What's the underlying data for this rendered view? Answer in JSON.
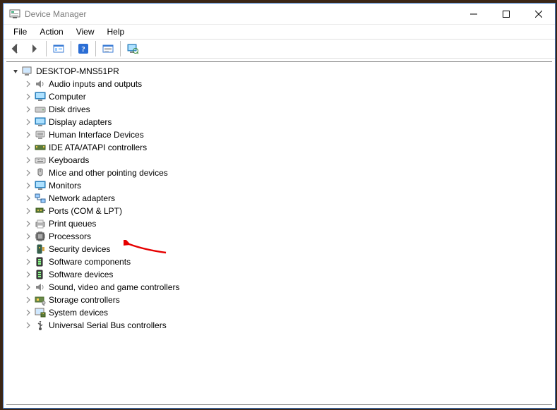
{
  "window": {
    "title": "Device Manager"
  },
  "menubar": {
    "items": [
      {
        "label": "File"
      },
      {
        "label": "Action"
      },
      {
        "label": "View"
      },
      {
        "label": "Help"
      }
    ]
  },
  "toolbar": {
    "back": "back-icon",
    "forward": "forward-icon",
    "show_hidden": "show-hidden-icon",
    "help": "help-icon",
    "properties": "properties-icon",
    "scan": "scan-monitor-icon"
  },
  "tree": {
    "root": {
      "label": "DESKTOP-MNS51PR",
      "expanded": true
    },
    "categories": [
      {
        "label": "Audio inputs and outputs",
        "icon": "speaker"
      },
      {
        "label": "Computer",
        "icon": "monitor"
      },
      {
        "label": "Disk drives",
        "icon": "disk"
      },
      {
        "label": "Display adapters",
        "icon": "monitor"
      },
      {
        "label": "Human Interface Devices",
        "icon": "hid"
      },
      {
        "label": "IDE ATA/ATAPI controllers",
        "icon": "ide"
      },
      {
        "label": "Keyboards",
        "icon": "keyboard"
      },
      {
        "label": "Mice and other pointing devices",
        "icon": "mouse"
      },
      {
        "label": "Monitors",
        "icon": "monitor"
      },
      {
        "label": "Network adapters",
        "icon": "network"
      },
      {
        "label": "Ports (COM & LPT)",
        "icon": "port"
      },
      {
        "label": "Print queues",
        "icon": "printer"
      },
      {
        "label": "Processors",
        "icon": "cpu"
      },
      {
        "label": "Security devices",
        "icon": "security",
        "highlighted": true
      },
      {
        "label": "Software components",
        "icon": "component"
      },
      {
        "label": "Software devices",
        "icon": "component"
      },
      {
        "label": "Sound, video and game controllers",
        "icon": "speaker"
      },
      {
        "label": "Storage controllers",
        "icon": "storage"
      },
      {
        "label": "System devices",
        "icon": "system"
      },
      {
        "label": "Universal Serial Bus controllers",
        "icon": "usb"
      }
    ]
  },
  "annotation": {
    "arrow_color": "#e60000",
    "target_index": 13
  }
}
